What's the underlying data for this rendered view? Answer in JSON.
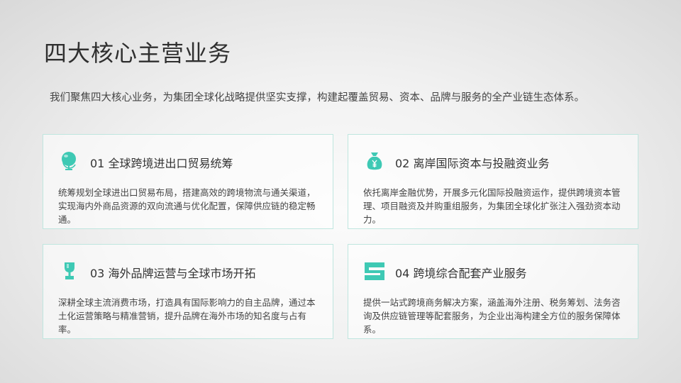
{
  "title": "四大核心主营业务",
  "subtitle": "我们聚焦四大核心业务，为集团全球化战略提供坚实支撑，构建起覆盖贸易、资本、品牌与服务的全产业链生态体系。",
  "accent_color": "#3ec9b4",
  "cards": [
    {
      "icon": "globe-icon",
      "title": "01 全球跨境进出口贸易统筹",
      "description": "统筹规划全球进出口贸易布局，搭建高效的跨境物流与通关渠道，实现海内外商品资源的双向流通与优化配置，保障供应链的稳定畅通。"
    },
    {
      "icon": "money-bag-icon",
      "title": "02 离岸国际资本与投融资业务",
      "description": "依托离岸金融优势，开展多元化国际投融资运作，提供跨境资本管理、项目融资及并购重组服务，为集团全球化扩张注入强劲资本动力。"
    },
    {
      "icon": "trophy-icon",
      "title": "03 海外品牌运营与全球市场开拓",
      "description": "深耕全球主流消费市场，打造具有国际影响力的自主品牌，通过本土化运营策略与精准营销，提升品牌在海外市场的知名度与占有率。"
    },
    {
      "icon": "workflow-icon",
      "title": "04 跨境综合配套产业服务",
      "description": "提供一站式跨境商务解决方案，涵盖海外注册、税务筹划、法务咨询及供应链管理等配套服务，为企业出海构建全方位的服务保障体系。"
    }
  ]
}
